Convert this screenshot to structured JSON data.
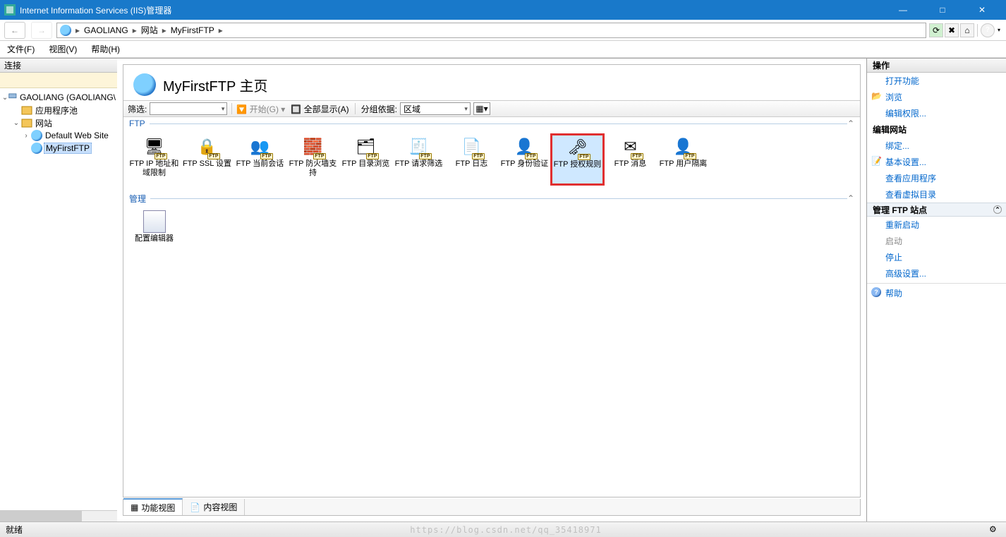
{
  "window": {
    "title": "Internet Information Services (IIS)管理器",
    "min": "—",
    "max": "□",
    "close": "✕"
  },
  "breadcrumb": {
    "root": "GAOLIANG",
    "mid": "网站",
    "leaf": "MyFirstFTP"
  },
  "menu": {
    "file": "文件(F)",
    "view": "视图(V)",
    "help": "帮助(H)"
  },
  "left": {
    "header": "连接",
    "root": "GAOLIANG (GAOLIANG\\",
    "apppool": "应用程序池",
    "sites": "网站",
    "default_site": "Default Web Site",
    "myftp": "MyFirstFTP"
  },
  "page": {
    "title": "MyFirstFTP 主页",
    "filter_label": "筛选:",
    "start_label": "开始(G)",
    "showall_label": "全部显示(A)",
    "groupby_label": "分组依据:",
    "groupby_value": "区域"
  },
  "groups": {
    "ftp": "FTP",
    "mgmt": "管理"
  },
  "ftp_items": [
    "FTP IP 地址和域限制",
    "FTP SSL 设置",
    "FTP 当前会话",
    "FTP 防火墙支持",
    "FTP 目录浏览",
    "FTP 请求筛选",
    "FTP 日志",
    "FTP 身份验证",
    "FTP 授权规则",
    "FTP 消息",
    "FTP 用户隔离"
  ],
  "mgmt_items": [
    "配置编辑器"
  ],
  "tabs": {
    "features": "功能视图",
    "content": "内容视图"
  },
  "actions": {
    "header": "操作",
    "open_feature": "打开功能",
    "browse": "浏览",
    "edit_perm": "编辑权限...",
    "edit_site_head": "编辑网站",
    "bindings": "绑定...",
    "basic_settings": "基本设置...",
    "view_apps": "查看应用程序",
    "view_vdirs": "查看虚拟目录",
    "manage_head": "管理 FTP 站点",
    "restart": "重新启动",
    "start": "启动",
    "stop": "停止",
    "advanced": "高级设置...",
    "help": "帮助"
  },
  "status": {
    "ready": "就绪",
    "watermark": "https://blog.csdn.net/qq_35418971"
  }
}
